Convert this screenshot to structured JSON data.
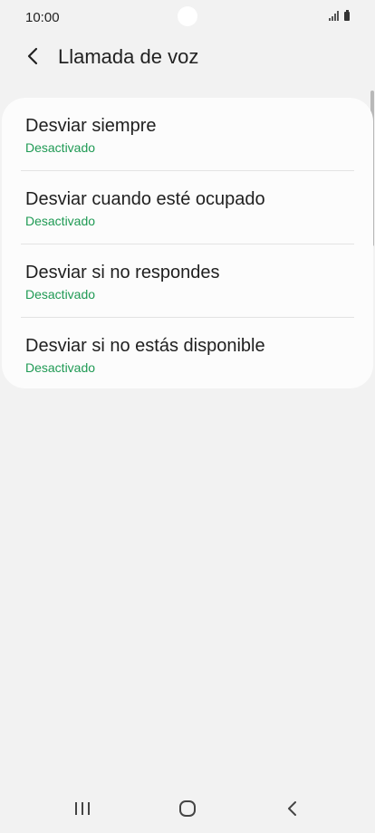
{
  "status_bar": {
    "time": "10:00",
    "icons": [
      "signal-icon",
      "battery-icon"
    ]
  },
  "header": {
    "back_icon": "chevron-left-icon",
    "title": "Llamada de voz"
  },
  "options": [
    {
      "title": "Desviar siempre",
      "status": "Desactivado"
    },
    {
      "title": "Desviar cuando esté ocupado",
      "status": "Desactivado"
    },
    {
      "title": "Desviar si no respondes",
      "status": "Desactivado"
    },
    {
      "title": "Desviar si no estás disponible",
      "status": "Desactivado"
    }
  ],
  "nav_bar": {
    "icons": [
      "recent-apps-icon",
      "home-icon",
      "back-icon"
    ]
  },
  "colors": {
    "background": "#f2f2f2",
    "card": "#fcfcfc",
    "status_accent": "#1f9a54",
    "text": "#1f1f1f"
  }
}
